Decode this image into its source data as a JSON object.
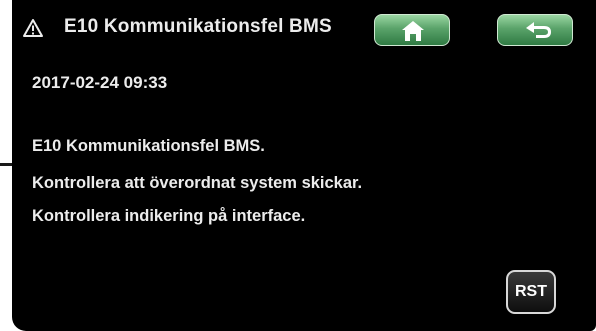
{
  "header": {
    "title": "E10 Kommunikationsfel BMS",
    "warning_icon": "warning-triangle-icon",
    "home_icon": "home-icon",
    "back_icon": "back-arrow-icon"
  },
  "alarm": {
    "timestamp": "2017-02-24 09:33",
    "lines": [
      "E10 Kommunikationsfel BMS.",
      "Kontrollera att överordnat system skickar.",
      "Kontrollera indikering på interface."
    ]
  },
  "footer": {
    "reset_label": "RST"
  },
  "colors": {
    "background": "#000000",
    "text": "#ececec",
    "button_green": "#5aa36a"
  }
}
